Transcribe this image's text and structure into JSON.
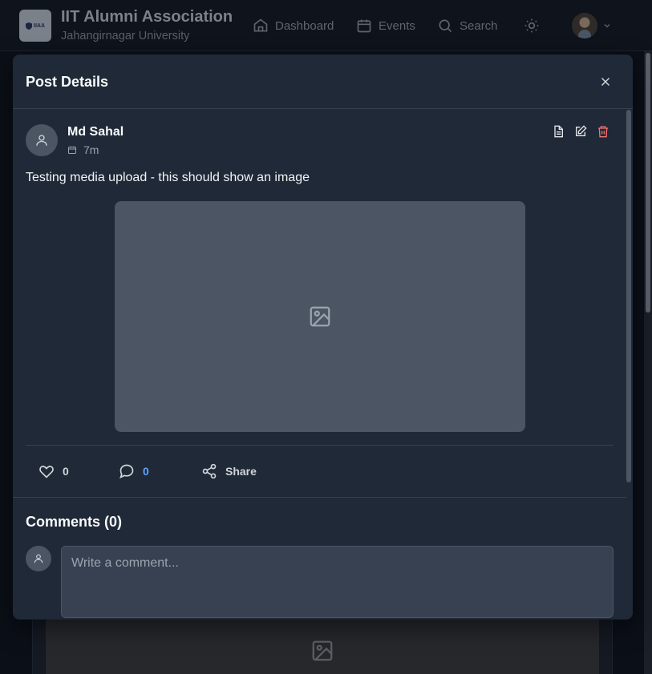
{
  "nav": {
    "logo_text": "IIAA",
    "title": "IIT Alumni Association",
    "subtitle": "Jahangirnagar University",
    "items": [
      {
        "label": "Dashboard",
        "icon": "home-icon"
      },
      {
        "label": "Events",
        "icon": "calendar-icon"
      },
      {
        "label": "Search",
        "icon": "search-icon"
      }
    ],
    "theme_icon": "sun-icon",
    "avatar_icon": "user-avatar",
    "menu_icon": "chevron-down-icon"
  },
  "modal": {
    "title": "Post Details",
    "close_icon": "close-icon",
    "post": {
      "author": "Md Sahal",
      "time": "7m",
      "text": "Testing media upload - this should show an image",
      "media_icon": "image-icon",
      "actions": [
        "document-icon",
        "edit-icon",
        "trash-icon"
      ],
      "likes": "0",
      "comments": "0",
      "share_label": "Share"
    },
    "comments": {
      "title": "Comments (0)",
      "placeholder": "Write a comment..."
    }
  },
  "colors": {
    "modal_bg": "#1f2937",
    "accent": "#60a5fa",
    "danger": "#f87171"
  }
}
